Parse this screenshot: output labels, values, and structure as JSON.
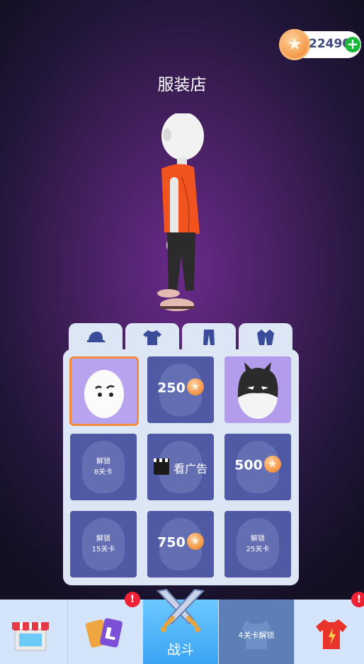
{
  "header": {
    "coins": "22490",
    "title": "服装店"
  },
  "categories": [
    {
      "icon": "cap-icon"
    },
    {
      "icon": "shirt-icon"
    },
    {
      "icon": "pants-icon"
    },
    {
      "icon": "suit-icon"
    }
  ],
  "items": [
    {
      "state": "selected"
    },
    {
      "price": "250"
    },
    {
      "state": "owned"
    },
    {
      "lock_line1": "解锁",
      "lock_line2": "8关卡"
    },
    {
      "ad_label": "看广告"
    },
    {
      "price": "500"
    },
    {
      "lock_line1": "解锁",
      "lock_line2": "15关卡"
    },
    {
      "price": "750"
    },
    {
      "lock_line1": "解锁",
      "lock_line2": "25关卡"
    }
  ],
  "nav": {
    "fight_label": "战斗",
    "locked_label": "4关卡解锁",
    "badge": "!"
  },
  "colors": {
    "accent": "#3aa4f4",
    "coin": "#f59a4b",
    "panel": "#dde6f5",
    "cell": "#4f59a4",
    "badge": "#ee2234",
    "plus": "#19b83a"
  }
}
